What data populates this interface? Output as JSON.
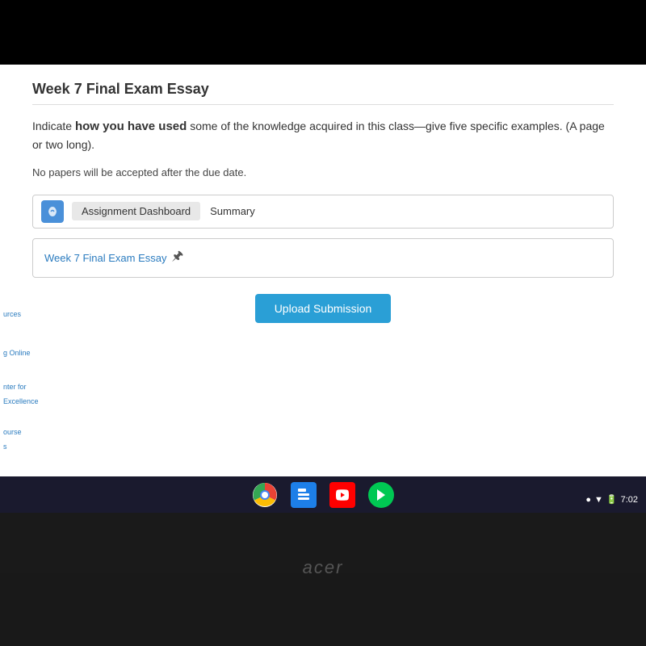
{
  "page": {
    "title": "Week 7 Final Exam Essay",
    "instruction_prefix": "Indicate ",
    "instruction_bold": "how you have used",
    "instruction_suffix": " some of the knowledge acquired in this class—give five specific examples. (A page or two long).",
    "notice": "No papers will be accepted after the due date.",
    "tabs": [
      {
        "id": "assignment-dashboard",
        "label": "Assignment Dashboard",
        "active": true
      },
      {
        "id": "summary",
        "label": "Summary",
        "active": false
      }
    ],
    "assignment_link": "Week 7 Final Exam Essay",
    "upload_button": "Upload Submission"
  },
  "sidebar": {
    "items": [
      {
        "label": "urces"
      },
      {
        "label": "g Online"
      },
      {
        "label": "nter for\nExcellence"
      },
      {
        "label": "ourse\ns"
      }
    ]
  },
  "taskbar": {
    "time": "7:02",
    "icons": [
      "chrome",
      "files",
      "youtube",
      "play"
    ]
  },
  "laptop": {
    "brand": "acer"
  }
}
